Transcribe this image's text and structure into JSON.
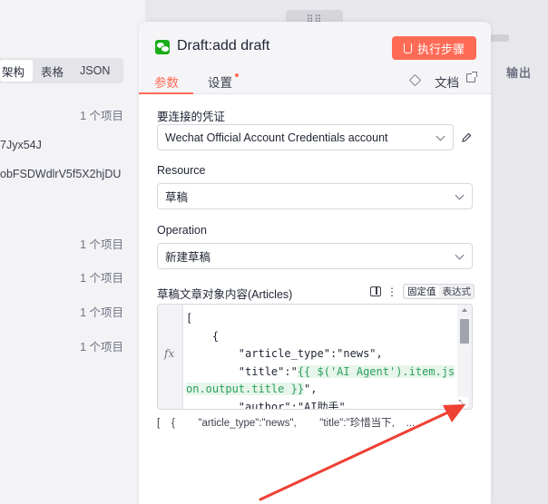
{
  "left_panel": {
    "tabs": [
      {
        "label": "架构"
      },
      {
        "label": "表格"
      },
      {
        "label": "JSON"
      }
    ],
    "counts": [
      "1 个项目",
      "1 个项目",
      "1 个项目",
      "1 个项目",
      "1 个项目"
    ],
    "texts": [
      "7Jyx54J",
      "obFSDWdlrV5f5X2hjDU"
    ]
  },
  "right_panel": {
    "title": "输出"
  },
  "node": {
    "title": "Draft:add draft",
    "execute_label": "执行步骤",
    "tabs": [
      {
        "label": "参数"
      },
      {
        "label": "设置"
      }
    ],
    "docs_label": "文档"
  },
  "form": {
    "credential": {
      "label": "要连接的凭证",
      "value": "Wechat Official Account Credentials account"
    },
    "resource": {
      "label": "Resource",
      "value": "草稿"
    },
    "operation": {
      "label": "Operation",
      "value": "新建草稿"
    },
    "articles": {
      "label": "草稿文章对象内容(Articles)",
      "mode_fixed": "固定值",
      "mode_expression": "表达式",
      "code_lines": [
        "[",
        "    {",
        "        \"article_type\":\"news\",",
        "        \"title\":\"",
        "on.output.title }}\",",
        "        \"author\":\"AI助手\","
      ],
      "code_expr_1": "{{ $('AI Agent').item.js",
      "code_expr_2": "on.output.title }}",
      "preview": "[    {        \"article_type\":\"news\",        \"title\":\"珍惜当下,    ..."
    }
  },
  "colors": {
    "accent": "#ff6b56",
    "expression_green": "#2aa05e",
    "annotation_red": "#ee4035"
  },
  "icons": [
    "wechat-icon",
    "flask-icon",
    "cube-icon",
    "external-link-icon",
    "pencil-icon",
    "panel-icon",
    "kebab-icon",
    "chevron-down-icon",
    "resize-icon"
  ]
}
